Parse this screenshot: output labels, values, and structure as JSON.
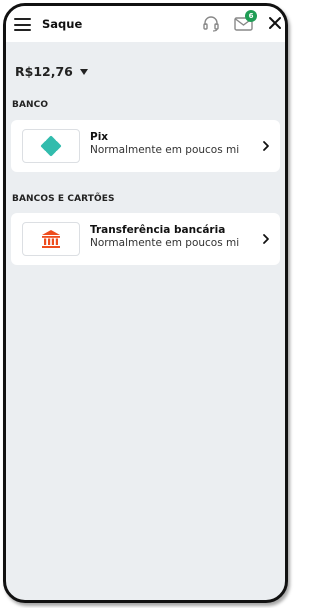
{
  "header": {
    "title": "Saque",
    "notification_count": "6",
    "icons": [
      "menu-icon",
      "headset-icon",
      "mail-icon",
      "close-icon"
    ]
  },
  "balance": {
    "amount": "R$12,76"
  },
  "sections": [
    {
      "label": "BANCO",
      "methods": [
        {
          "name": "Pix",
          "subtitle": "Normalmente em poucos minutos",
          "icon": "pix-icon"
        }
      ]
    },
    {
      "label": "BANCOS E CARTÕES",
      "methods": [
        {
          "name": "Transferência bancária",
          "subtitle": "Normalmente em poucos minutos",
          "icon": "bank-icon"
        }
      ]
    }
  ],
  "colors": {
    "background": "#ebeef1",
    "pix": "#32bcad",
    "bank": "#ee4d1e",
    "badge": "#1f9d55"
  }
}
